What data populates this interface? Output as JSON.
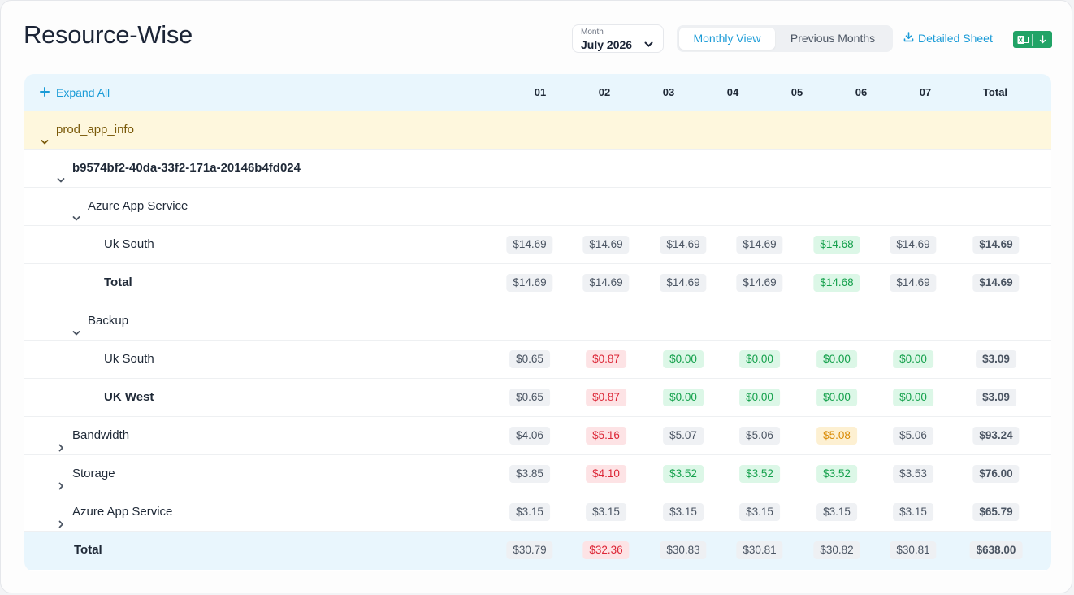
{
  "title": "Resource-Wise",
  "month": {
    "caption": "Month",
    "value": "July 2026"
  },
  "view_toggle": {
    "active": "Monthly View",
    "inactive": "Previous Months"
  },
  "detailed_sheet": "Detailed Sheet",
  "colors": {
    "accent": "#1a9bd7",
    "increase": "#dc2737",
    "decrease": "#14a04b",
    "warning": "#d98b06",
    "excel": "#21a366"
  },
  "table": {
    "expand_all": "Expand All",
    "columns": [
      "01",
      "02",
      "03",
      "04",
      "05",
      "06",
      "07",
      "Total"
    ],
    "rows": [
      {
        "label": "prod_app_info",
        "level": 0,
        "expanded": true,
        "kind": "group"
      },
      {
        "label": "b9574bf2-40da-33f2-171a-20146b4fd024",
        "level": 1,
        "expanded": true,
        "bold": true
      },
      {
        "label": "Azure App Service",
        "level": 2,
        "expanded": true
      },
      {
        "label": "Uk South",
        "level": 3,
        "values": [
          "$14.69",
          "$14.69",
          "$14.69",
          "$14.69",
          "$14.68",
          "$14.69",
          "$14.69"
        ],
        "colors": [
          "neutral",
          "neutral",
          "neutral",
          "neutral",
          "green",
          "neutral",
          "neutral"
        ]
      },
      {
        "label": "Total",
        "level": 3,
        "bold": true,
        "values": [
          "$14.69",
          "$14.69",
          "$14.69",
          "$14.69",
          "$14.68",
          "$14.69",
          "$14.69"
        ],
        "colors": [
          "neutral",
          "neutral",
          "neutral",
          "neutral",
          "green",
          "neutral",
          "neutral"
        ]
      },
      {
        "label": "Backup",
        "level": 2,
        "expanded": true
      },
      {
        "label": "Uk South",
        "level": 3,
        "values": [
          "$0.65",
          "$0.87",
          "$0.00",
          "$0.00",
          "$0.00",
          "$0.00",
          "$3.09"
        ],
        "colors": [
          "neutral",
          "red",
          "green",
          "green",
          "green",
          "green",
          "neutral"
        ]
      },
      {
        "label": "UK West",
        "level": 3,
        "bold": true,
        "values": [
          "$0.65",
          "$0.87",
          "$0.00",
          "$0.00",
          "$0.00",
          "$0.00",
          "$3.09"
        ],
        "colors": [
          "neutral",
          "red",
          "green",
          "green",
          "green",
          "green",
          "neutral"
        ]
      },
      {
        "label": "Bandwidth",
        "level": 1,
        "expanded": false,
        "values": [
          "$4.06",
          "$5.16",
          "$5.07",
          "$5.06",
          "$5.08",
          "$5.06",
          "$93.24"
        ],
        "colors": [
          "neutral",
          "red",
          "neutral",
          "neutral",
          "orange",
          "neutral",
          "neutral"
        ]
      },
      {
        "label": "Storage",
        "level": 1,
        "expanded": false,
        "values": [
          "$3.85",
          "$4.10",
          "$3.52",
          "$3.52",
          "$3.52",
          "$3.53",
          "$76.00"
        ],
        "colors": [
          "neutral",
          "red",
          "green",
          "green",
          "green",
          "neutral",
          "neutral"
        ]
      },
      {
        "label": "Azure App Service",
        "level": 1,
        "expanded": false,
        "values": [
          "$3.15",
          "$3.15",
          "$3.15",
          "$3.15",
          "$3.15",
          "$3.15",
          "$65.79"
        ],
        "colors": [
          "neutral",
          "neutral",
          "neutral",
          "neutral",
          "neutral",
          "neutral",
          "neutral"
        ]
      },
      {
        "label": "Total",
        "level": 1,
        "bold": true,
        "kind": "footer",
        "values": [
          "$30.79",
          "$32.36",
          "$30.83",
          "$30.81",
          "$30.82",
          "$30.81",
          "$638.00"
        ],
        "colors": [
          "neutral",
          "red",
          "neutral",
          "neutral",
          "neutral",
          "neutral",
          "neutral"
        ]
      }
    ]
  }
}
